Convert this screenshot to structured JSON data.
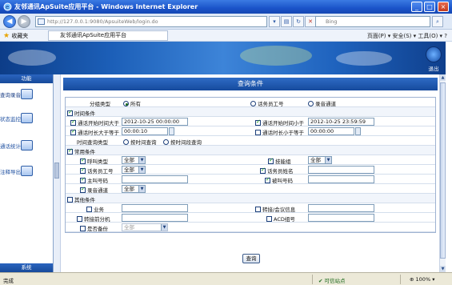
{
  "window": {
    "title": "友邻通讯ApSuite应用平台 - Windows Internet Explorer",
    "minimize": "_",
    "maximize": "□",
    "close": "×"
  },
  "addressbar": {
    "url": "http://127.0.0.1:9080/ApsuiteWeb/login.do",
    "search_placeholder": "Bing"
  },
  "favbar": {
    "favorites": "收藏夹",
    "tab": "友邻通讯ApSuite应用平台",
    "tools": "页面(P) ▾  安全(S) ▾  工具(O) ▾  ?"
  },
  "header": {
    "exit_label": "退出"
  },
  "sidebar": {
    "header": "功能",
    "items": [
      {
        "label": "查询录音"
      },
      {
        "label": "状态监控"
      },
      {
        "label": "通话统计"
      },
      {
        "label": "注释导出"
      }
    ],
    "footer": "系统"
  },
  "panel": {
    "title": "查询条件"
  },
  "form": {
    "group_type": {
      "label": "分组类型",
      "opt_all": "所有",
      "opt_agent": "话务员工号",
      "opt_channel": "录音通道"
    },
    "time_section": "时间条件",
    "start_after": {
      "label": "通话开始时间大于",
      "value": "2012-10-25 00:00:00"
    },
    "start_before": {
      "label": "通话开始时间小于",
      "value": "2012-10-25 23:59:59"
    },
    "duration_gt": {
      "label": "通话时长大于等于",
      "value": "00:00:10"
    },
    "duration_lt": {
      "label": "通话时长小于等于",
      "value": "00:00:00"
    },
    "time_query_type": {
      "label": "时间查询类型",
      "opt_by_time": "按时间查询",
      "opt_by_period": "按时间段查询"
    },
    "common_section": "常用条件",
    "call_type": {
      "label": "呼叫类型",
      "value": "全部"
    },
    "skill_group": {
      "label": "技能组",
      "value": "全部"
    },
    "agent_id": {
      "label": "话务员工号",
      "value": "全部"
    },
    "agent_name": {
      "label": "话务员姓名",
      "value": ""
    },
    "caller": {
      "label": "主叫号码",
      "value": ""
    },
    "callee": {
      "label": "被叫号码",
      "value": ""
    },
    "channel": {
      "label": "录音通道",
      "value": "全部"
    },
    "other_section": "其他条件",
    "business": {
      "label": "业务",
      "value": ""
    },
    "transfer": {
      "label": "转接/会议信息",
      "value": ""
    },
    "transfer_ext": {
      "label": "转接前分机",
      "value": ""
    },
    "acd_group": {
      "label": "ACD组号",
      "value": ""
    },
    "backup": {
      "label": "是否备份",
      "value": "全部"
    },
    "query_button": "查询"
  },
  "statusbar": {
    "status": "完成",
    "zone": "可信站点",
    "zoom": "100%"
  }
}
